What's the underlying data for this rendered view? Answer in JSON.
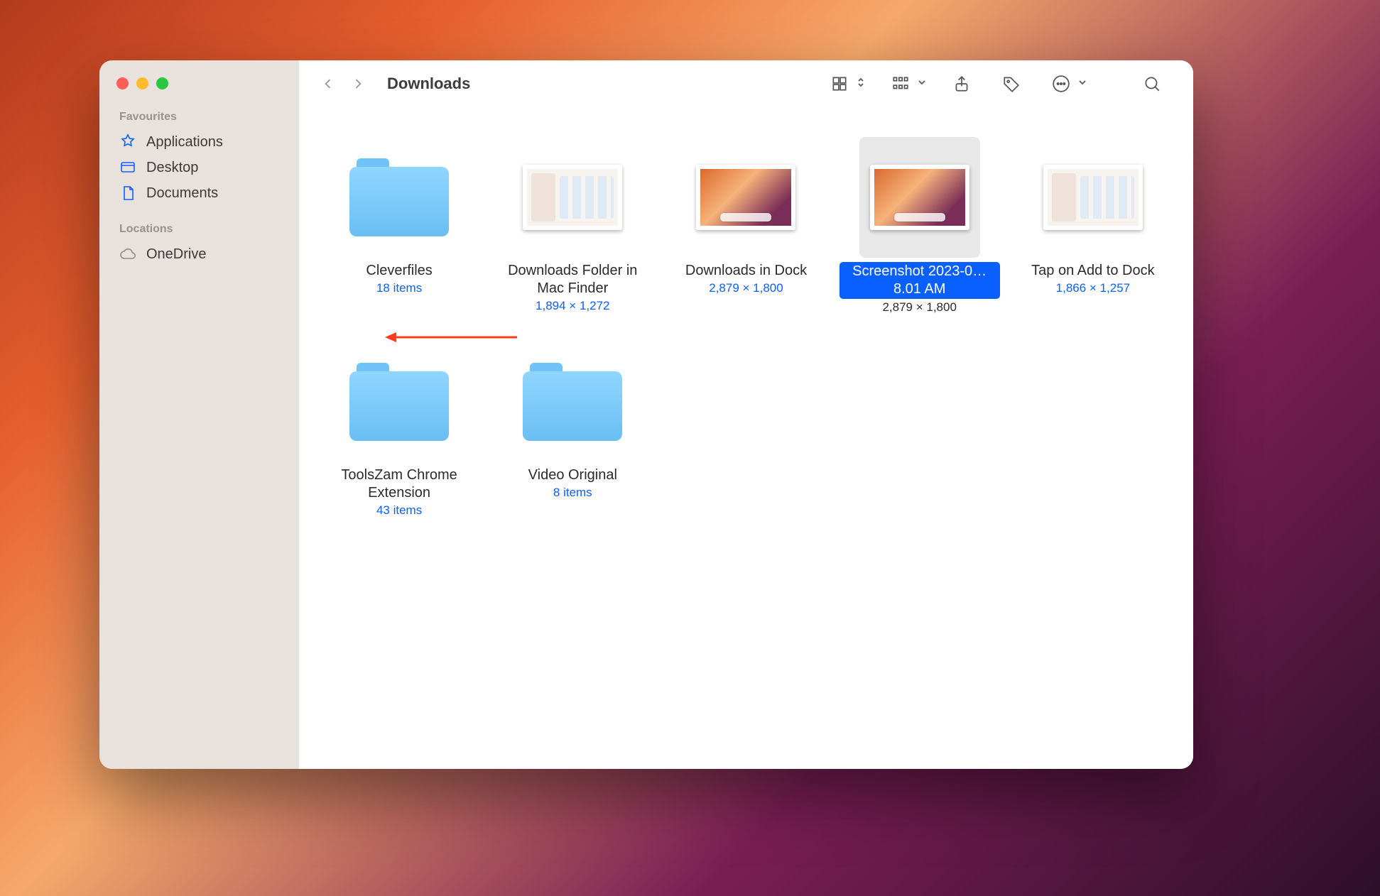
{
  "window": {
    "title": "Downloads"
  },
  "sidebar": {
    "section_fav": "Favourites",
    "section_loc": "Locations",
    "fav": [
      {
        "label": "Applications"
      },
      {
        "label": "Desktop"
      },
      {
        "label": "Documents"
      }
    ],
    "loc": [
      {
        "label": "OneDrive"
      }
    ]
  },
  "items": [
    {
      "name": "Cleverfiles",
      "sub": "18 items",
      "kind": "folder",
      "selected": false
    },
    {
      "name": "Downloads Folder in Mac Finder",
      "sub": "1,894 × 1,272",
      "kind": "thumb-finder",
      "selected": false
    },
    {
      "name": "Downloads in Dock",
      "sub": "2,879 × 1,800",
      "kind": "thumb-dock",
      "selected": false
    },
    {
      "name": "Screenshot 2023-0…8.01 AM",
      "sub": "2,879 × 1,800",
      "kind": "thumb-dock",
      "selected": true
    },
    {
      "name": "Tap on Add to Dock",
      "sub": "1,866 × 1,257",
      "kind": "thumb-finder",
      "selected": false
    },
    {
      "name": "ToolsZam Chrome Extension",
      "sub": "43 items",
      "kind": "folder",
      "selected": false
    },
    {
      "name": "Video Original",
      "sub": "8 items",
      "kind": "folder",
      "selected": false
    }
  ]
}
